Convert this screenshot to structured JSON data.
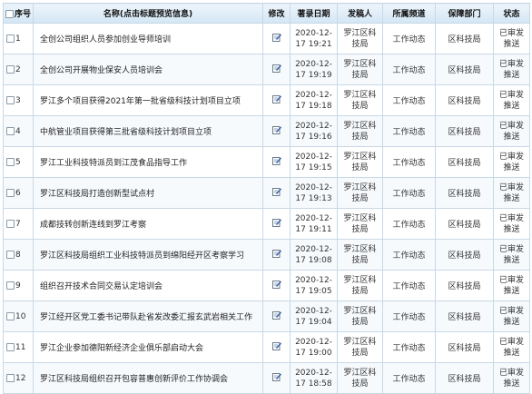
{
  "table": {
    "headers": {
      "index": "序号",
      "title": "名称(点击标题预览信息)",
      "edit": "修改",
      "date": "著录日期",
      "publisher": "发稿人",
      "channel": "所属频道",
      "dept": "保障部门",
      "status": "状态"
    },
    "rows": [
      {
        "index": "1",
        "title": "全创公司组织人员参加创业导师培训",
        "date1": "2020-12-",
        "date2": "17 19:21",
        "pub1": "罗江区科",
        "pub2": "技局",
        "channel": "工作动态",
        "dept": "区科技局",
        "stat1": "已审发",
        "stat2": "推送"
      },
      {
        "index": "2",
        "title": "全创公司开展物业保安人员培训会",
        "date1": "2020-12-",
        "date2": "17 19:19",
        "pub1": "罗江区科",
        "pub2": "技局",
        "channel": "工作动态",
        "dept": "区科技局",
        "stat1": "已审发",
        "stat2": "推送"
      },
      {
        "index": "3",
        "title": "罗江多个项目获得2021年第一批省级科技计划项目立项",
        "date1": "2020-12-",
        "date2": "17 19:18",
        "pub1": "罗江区科",
        "pub2": "技局",
        "channel": "工作动态",
        "dept": "区科技局",
        "stat1": "已审发",
        "stat2": "推送"
      },
      {
        "index": "4",
        "title": "中航管业项目获得第三批省级科技计划项目立项",
        "date1": "2020-12-",
        "date2": "17 19:16",
        "pub1": "罗江区科",
        "pub2": "技局",
        "channel": "工作动态",
        "dept": "区科技局",
        "stat1": "已审发",
        "stat2": "推送"
      },
      {
        "index": "5",
        "title": "罗江工业科技特派员到江茂食品指导工作",
        "date1": "2020-12-",
        "date2": "17 19:15",
        "pub1": "罗江区科",
        "pub2": "技局",
        "channel": "工作动态",
        "dept": "区科技局",
        "stat1": "已审发",
        "stat2": "推送"
      },
      {
        "index": "6",
        "title": "罗江区科技局打造创新型试点村",
        "date1": "2020-12-",
        "date2": "17 19:13",
        "pub1": "罗江区科",
        "pub2": "技局",
        "channel": "工作动态",
        "dept": "区科技局",
        "stat1": "已审发",
        "stat2": "推送"
      },
      {
        "index": "7",
        "title": "成都技转创新连线到罗江考察",
        "date1": "2020-12-",
        "date2": "17 19:11",
        "pub1": "罗江区科",
        "pub2": "技局",
        "channel": "工作动态",
        "dept": "区科技局",
        "stat1": "已审发",
        "stat2": "推送"
      },
      {
        "index": "8",
        "title": "罗江区科技局组织工业科技特派员到绵阳经开区考察学习",
        "date1": "2020-12-",
        "date2": "17 19:08",
        "pub1": "罗江区科",
        "pub2": "技局",
        "channel": "工作动态",
        "dept": "区科技局",
        "stat1": "已审发",
        "stat2": "推送"
      },
      {
        "index": "9",
        "title": "组织召开技术合同交易认定培训会",
        "date1": "2020-12-",
        "date2": "17 19:05",
        "pub1": "罗江区科",
        "pub2": "技局",
        "channel": "工作动态",
        "dept": "区科技局",
        "stat1": "已审发",
        "stat2": "推送"
      },
      {
        "index": "10",
        "title": "罗江经开区党工委书记带队赴省发改委汇报玄武岩相关工作",
        "date1": "2020-12-",
        "date2": "17 19:04",
        "pub1": "罗江区科",
        "pub2": "技局",
        "channel": "工作动态",
        "dept": "区科技局",
        "stat1": "已审发",
        "stat2": "推送"
      },
      {
        "index": "11",
        "title": "罗江企业参加德阳新经济企业俱乐部启动大会",
        "date1": "2020-12-",
        "date2": "17 19:00",
        "pub1": "罗江区科",
        "pub2": "技局",
        "channel": "工作动态",
        "dept": "区科技局",
        "stat1": "已审发",
        "stat2": "推送"
      },
      {
        "index": "12",
        "title": "罗江区科技局组织召开包容普惠创新评价工作协调会",
        "date1": "2020-12-",
        "date2": "17 18:58",
        "pub1": "罗江区科",
        "pub2": "技局",
        "channel": "工作动态",
        "dept": "区科技局",
        "stat1": "已审发",
        "stat2": "推送"
      }
    ]
  },
  "icons": {
    "checkbox": "checkbox-icon",
    "edit": "edit-icon"
  }
}
